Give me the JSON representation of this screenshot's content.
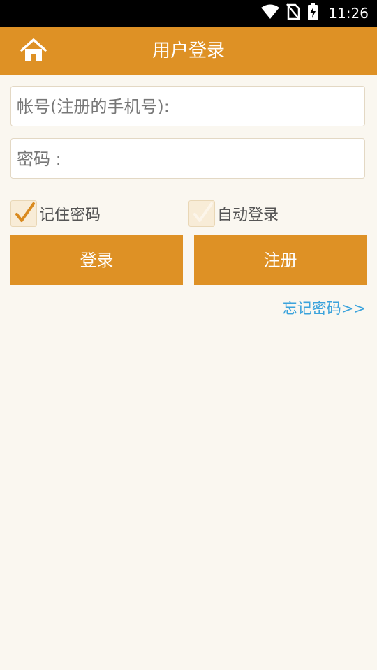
{
  "status_bar": {
    "time": "11:26"
  },
  "header": {
    "title": "用户登录"
  },
  "form": {
    "account_label": "帐号(注册的手机号):",
    "password_label": "密码 :"
  },
  "options": {
    "remember_password": {
      "label": "记住密码",
      "checked": true
    },
    "auto_login": {
      "label": "自动登录",
      "checked": false
    }
  },
  "buttons": {
    "login": "登录",
    "register": "注册"
  },
  "links": {
    "forgot_password": "忘记密码>>"
  },
  "colors": {
    "primary": "#de9125",
    "background": "#faf7f0",
    "link": "#3ba3dc"
  }
}
